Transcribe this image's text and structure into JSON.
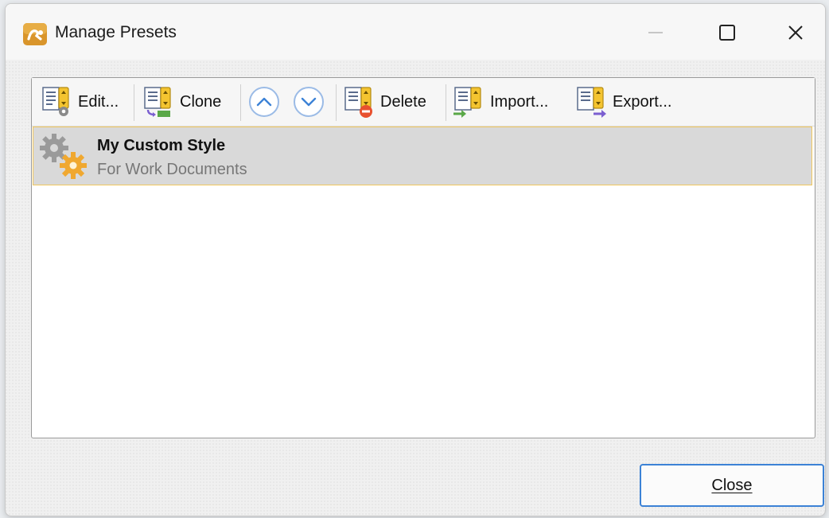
{
  "window": {
    "title": "Manage Presets"
  },
  "toolbar": {
    "edit_label": "Edit...",
    "clone_label": "Clone",
    "delete_label": "Delete",
    "import_label": "Import...",
    "export_label": "Export..."
  },
  "presets": [
    {
      "name": "My Custom Style",
      "description": "For Work Documents"
    }
  ],
  "footer": {
    "close_label": "Close"
  },
  "colors": {
    "selection_bg": "#d9d9d9",
    "selection_border": "#f1c75d",
    "accent_blue": "#3c82d6",
    "icon_yellow": "#f4c430"
  },
  "icons": {
    "window_min": "minimize-icon",
    "window_max": "maximize-icon",
    "window_close": "close-icon",
    "move_up": "chevron-up-icon",
    "move_down": "chevron-down-icon"
  }
}
